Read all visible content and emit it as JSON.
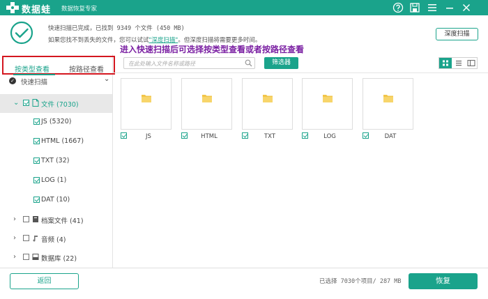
{
  "titlebar": {
    "app_name": "数据蛙",
    "subtitle": "数据恢复专家",
    "icons": [
      "help-icon",
      "save-icon",
      "menu-icon",
      "minimize-icon",
      "close-icon"
    ]
  },
  "info": {
    "line1": "快速扫描已完成，已找到 9349 个文件 (450 MB)",
    "line2_prefix": "如果您找不到丢失的文件，您可以试试",
    "line2_link": "\"深度扫描\"",
    "line2_suffix": "。但深度扫描将需要更多时间。",
    "deep_scan_label": "深度扫描"
  },
  "annotation": "进入快速扫描后可选择按类型查看或者按路径查看",
  "tabs": [
    {
      "label": "按类型查看",
      "active": true
    },
    {
      "label": "按路径查看",
      "active": false
    }
  ],
  "scan_mode": "快速扫描",
  "tree": {
    "root": {
      "label": "文件 (7030)"
    },
    "children": [
      {
        "label": "JS (5320)"
      },
      {
        "label": "HTML (1667)"
      },
      {
        "label": "TXT (32)"
      },
      {
        "label": "LOG (1)"
      },
      {
        "label": "DAT (10)"
      }
    ],
    "others": [
      {
        "label": "档案文件 (41)"
      },
      {
        "label": "音频 (4)"
      },
      {
        "label": "数据库 (22)"
      }
    ]
  },
  "search": {
    "placeholder": "在此处输入文件名称或路径"
  },
  "filter_label": "筛选器",
  "files": [
    {
      "label": "JS"
    },
    {
      "label": "HTML"
    },
    {
      "label": "TXT"
    },
    {
      "label": "LOG"
    },
    {
      "label": "DAT"
    }
  ],
  "bottom": {
    "back_label": "返回",
    "selected_text": "已选择 7030个项目/ 287 MB",
    "recover_label": "恢复"
  },
  "colors": {
    "accent": "#1aa38b",
    "annotation": "#7a1fa2",
    "highlight": "#d4161f"
  }
}
